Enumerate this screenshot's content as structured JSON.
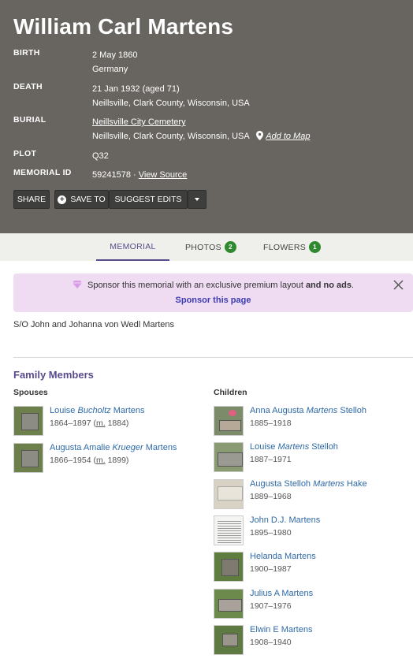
{
  "header": {
    "title": "William Carl Martens",
    "birth_label": "BIRTH",
    "birth_date": "2 May 1860",
    "birth_place": "Germany",
    "death_label": "DEATH",
    "death_date": "21 Jan 1932 (aged 71)",
    "death_place": "Neillsville, Clark County, Wisconsin, USA",
    "burial_label": "BURIAL",
    "burial_cemetery": "Neillsville City Cemetery",
    "burial_place": "Neillsville, Clark County, Wisconsin, USA",
    "add_to_map": "Add to Map",
    "plot_label": "PLOT",
    "plot_value": "Q32",
    "memorial_id_label": "MEMORIAL ID",
    "memorial_id": "59241578 · ",
    "view_source": "View Source"
  },
  "buttons": {
    "share": "SHARE",
    "save_to": "SAVE TO",
    "suggest_edits": "SUGGEST EDITS"
  },
  "tabs": {
    "memorial": "MEMORIAL",
    "photos": "PHOTOS",
    "photos_count": "2",
    "flowers": "FLOWERS",
    "flowers_count": "1"
  },
  "sponsor": {
    "text_a": "Sponsor this memorial with an exclusive premium layout ",
    "text_b": "and no ads",
    "text_c": ".",
    "link": "Sponsor this page"
  },
  "bio": "S/O John and Johanna von Wedl Martens",
  "family": {
    "title": "Family Members",
    "spouses_label": "Spouses",
    "children_label": "Children",
    "spouses": [
      {
        "first": "Louise ",
        "maiden": "Bucholtz",
        "last": " Martens",
        "dates": "1864–1897 (",
        "m": "m.",
        "year": " 1884)"
      },
      {
        "first": "Augusta Amalie ",
        "maiden": "Krueger",
        "last": " Martens",
        "dates": "1866–1954 (",
        "m": "m.",
        "year": " 1899)"
      }
    ],
    "children": [
      {
        "first": "Anna Augusta ",
        "maiden": "Martens",
        "last": " Stelloh",
        "dates": "1885–1918"
      },
      {
        "first": "Louise ",
        "maiden": "Martens",
        "last": " Stelloh",
        "dates": "1887–1971"
      },
      {
        "first": "Augusta Stelloh ",
        "maiden": "Martens",
        "last": " Hake",
        "dates": "1889–1968"
      },
      {
        "first": "John D.J. Martens",
        "maiden": "",
        "last": "",
        "dates": "1895–1980"
      },
      {
        "first": "Helanda Martens",
        "maiden": "",
        "last": "",
        "dates": "1900–1987"
      },
      {
        "first": "Julius A Martens",
        "maiden": "",
        "last": "",
        "dates": "1907–1976"
      },
      {
        "first": "Elwin E Martens",
        "maiden": "",
        "last": "",
        "dates": "1908–1940"
      }
    ]
  },
  "colors": {
    "header_bg": "#686560",
    "accent": "#5a4c8c",
    "link": "#2f6aa8",
    "badge": "#2e8a2e",
    "sponsor_bg": "#efdcf3"
  }
}
